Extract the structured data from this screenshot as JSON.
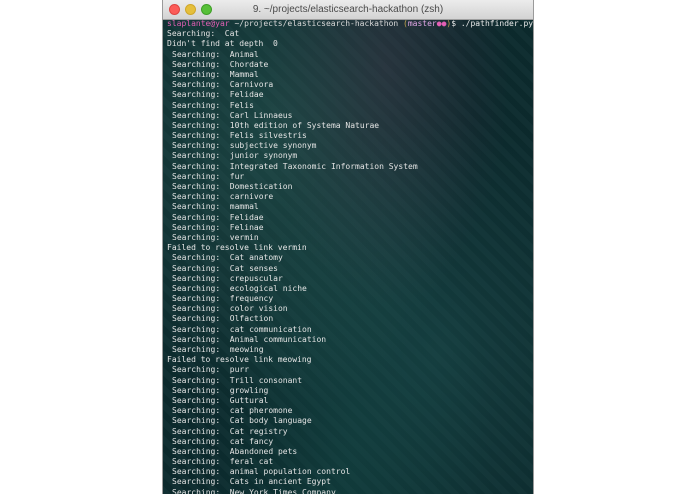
{
  "window": {
    "title": "9. ~/projects/elasticsearch-hackathon (zsh)"
  },
  "prompt": {
    "user_host": "slaplante@yar",
    "path": " ~/projects/elasticsearch-hackathon ",
    "git_open": "(",
    "branch": "master",
    "dots": "●●",
    "git_close": ")",
    "symbol": "$ ",
    "command": "./pathfinder.py Cat London"
  },
  "output": [
    {
      "text": "Searching:  Cat",
      "kind": "header"
    },
    {
      "text": "Didn't find at depth  0",
      "kind": "header"
    },
    {
      "text": "Searching:  Animal",
      "kind": "search"
    },
    {
      "text": "Searching:  Chordate",
      "kind": "search"
    },
    {
      "text": "Searching:  Mammal",
      "kind": "search"
    },
    {
      "text": "Searching:  Carnivora",
      "kind": "search"
    },
    {
      "text": "Searching:  Felidae",
      "kind": "search"
    },
    {
      "text": "Searching:  Felis",
      "kind": "search"
    },
    {
      "text": "Searching:  Carl Linnaeus",
      "kind": "search"
    },
    {
      "text": "Searching:  10th edition of Systema Naturae",
      "kind": "search"
    },
    {
      "text": "Searching:  Felis silvestris",
      "kind": "search"
    },
    {
      "text": "Searching:  subjective synonym",
      "kind": "search"
    },
    {
      "text": "Searching:  junior synonym",
      "kind": "search"
    },
    {
      "text": "Searching:  Integrated Taxonomic Information System",
      "kind": "search"
    },
    {
      "text": "Searching:  fur",
      "kind": "search"
    },
    {
      "text": "Searching:  Domestication",
      "kind": "search"
    },
    {
      "text": "Searching:  carnivore",
      "kind": "search"
    },
    {
      "text": "Searching:  mammal",
      "kind": "search"
    },
    {
      "text": "Searching:  Felidae",
      "kind": "search"
    },
    {
      "text": "Searching:  Felinae",
      "kind": "search"
    },
    {
      "text": "Searching:  vermin",
      "kind": "search"
    },
    {
      "text": "Failed to resolve link vermin",
      "kind": "fail"
    },
    {
      "text": "Searching:  Cat anatomy",
      "kind": "search"
    },
    {
      "text": "Searching:  Cat senses",
      "kind": "search"
    },
    {
      "text": "Searching:  crepuscular",
      "kind": "search"
    },
    {
      "text": "Searching:  ecological niche",
      "kind": "search"
    },
    {
      "text": "Searching:  frequency",
      "kind": "search"
    },
    {
      "text": "Searching:  color vision",
      "kind": "search"
    },
    {
      "text": "Searching:  Olfaction",
      "kind": "search"
    },
    {
      "text": "Searching:  cat communication",
      "kind": "search"
    },
    {
      "text": "Searching:  Animal communication",
      "kind": "search"
    },
    {
      "text": "Searching:  meowing",
      "kind": "search"
    },
    {
      "text": "Failed to resolve link meowing",
      "kind": "fail"
    },
    {
      "text": "Searching:  purr",
      "kind": "search"
    },
    {
      "text": "Searching:  Trill consonant",
      "kind": "search"
    },
    {
      "text": "Searching:  growling",
      "kind": "search"
    },
    {
      "text": "Searching:  Guttural",
      "kind": "search"
    },
    {
      "text": "Searching:  cat pheromone",
      "kind": "search"
    },
    {
      "text": "Searching:  Cat body language",
      "kind": "search"
    },
    {
      "text": "Searching:  Cat registry",
      "kind": "search"
    },
    {
      "text": "Searching:  cat fancy",
      "kind": "search"
    },
    {
      "text": "Searching:  Abandoned pets",
      "kind": "search"
    },
    {
      "text": "Searching:  feral cat",
      "kind": "search"
    },
    {
      "text": "Searching:  animal population control",
      "kind": "search"
    },
    {
      "text": "Searching:  Cats in ancient Egypt",
      "kind": "search"
    },
    {
      "text": "Searching:  New York Times Company",
      "kind": "search"
    }
  ]
}
